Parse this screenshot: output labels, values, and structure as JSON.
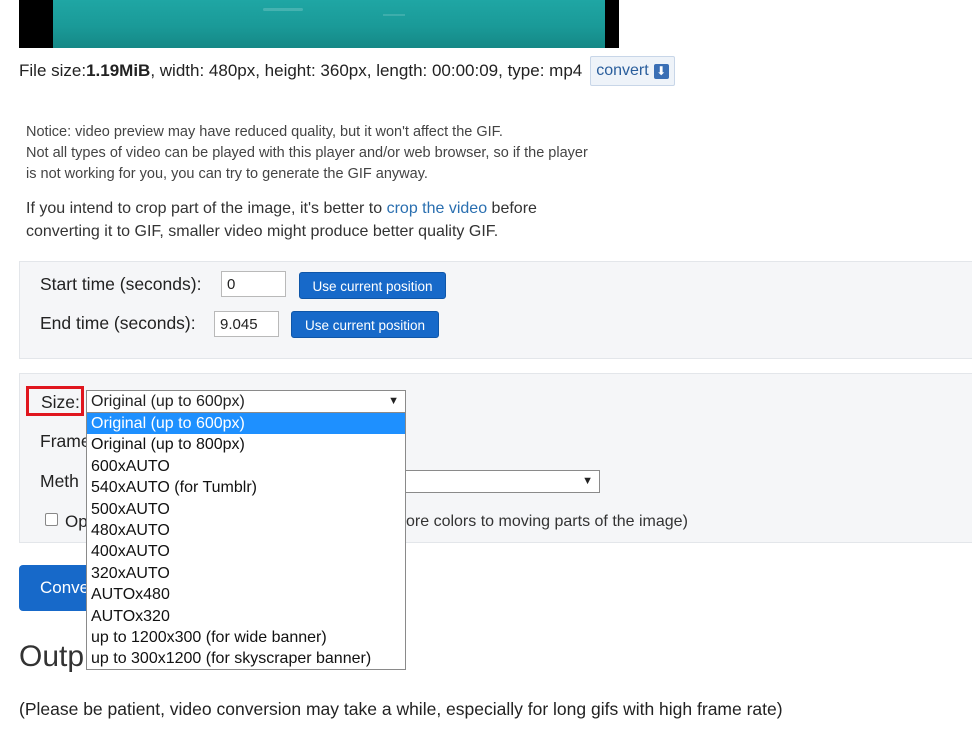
{
  "file_info": {
    "size_label": "File size: ",
    "size_value": "1.19MiB",
    "rest": ", width: 480px, height: 360px, length: 00:00:09, type: mp4",
    "convert_label": "convert"
  },
  "notice": {
    "line1": "Notice: video preview may have reduced quality, but it won't affect the GIF.",
    "line2": "Not all types of video can be played with this player and/or web browser, so if the player",
    "line3": "is not working for you, you can try to generate the GIF anyway."
  },
  "crop_note": {
    "before": "If you intend to crop part of the image, it's better to ",
    "link": "crop the video",
    "after": " before",
    "line2": "converting it to GIF, smaller video might produce better quality GIF."
  },
  "start_time": {
    "label": "Start time (seconds):",
    "value": "0",
    "button": "Use current position"
  },
  "end_time": {
    "label": "End time (seconds):",
    "value": "9.045",
    "button": "Use current position"
  },
  "size": {
    "label": "Size:",
    "selected": "Original (up to 600px)",
    "options": [
      "Original (up to 600px)",
      "Original (up to 800px)",
      "600xAUTO",
      "540xAUTO (for Tumblr)",
      "500xAUTO",
      "480xAUTO",
      "400xAUTO",
      "320xAUTO",
      "AUTOx480",
      "AUTOx320",
      "up to 1200x300 (for wide banner)",
      "up to 300x1200 (for skyscraper banner)"
    ]
  },
  "frame_label_partial": "Frame",
  "method_label_partial": "Meth",
  "optimize": {
    "label_partial": "Op",
    "text_tail": "ore colors to moving parts of the image)"
  },
  "convert_main_partial": "Conve",
  "output_heading_partial": "Outp",
  "patient_note": "(Please be patient, video conversion may take a while, especially for long gifs with high frame rate)"
}
